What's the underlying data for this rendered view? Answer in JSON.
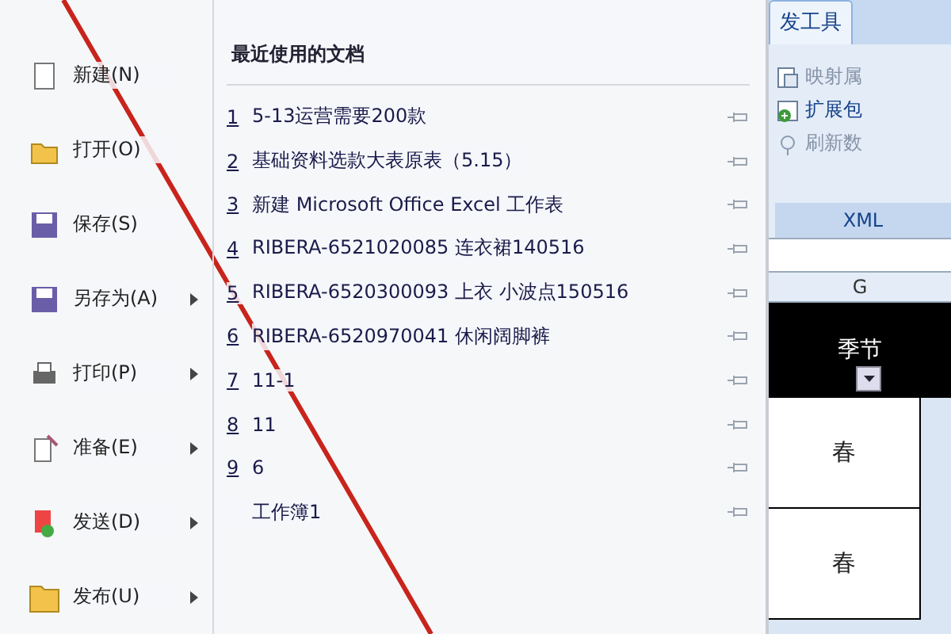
{
  "ribbon": {
    "tab": "发工具",
    "group": {
      "items": [
        {
          "label": "映射属"
        },
        {
          "label": "扩展包"
        },
        {
          "label": "刷新数"
        }
      ],
      "label": "XML"
    }
  },
  "sheet": {
    "column": "G",
    "header": "季节",
    "cells": [
      "春",
      "春"
    ]
  },
  "office_menu": {
    "commands": [
      {
        "label": "新建(N)",
        "submenu": false
      },
      {
        "label": "打开(O)",
        "submenu": false
      },
      {
        "label": "保存(S)",
        "submenu": false
      },
      {
        "label": "另存为(A)",
        "submenu": true
      },
      {
        "label": "打印(P)",
        "submenu": true
      },
      {
        "label": "准备(E)",
        "submenu": true
      },
      {
        "label": "发送(D)",
        "submenu": true
      },
      {
        "label": "发布(U)",
        "submenu": true
      }
    ],
    "recent": {
      "title": "最近使用的文档",
      "files": [
        {
          "number": "1",
          "name": "5-13运营需要200款"
        },
        {
          "number": "2",
          "name": "基础资料选款大表原表（5.15）"
        },
        {
          "number": "3",
          "name": "新建 Microsoft Office Excel 工作表"
        },
        {
          "number": "4",
          "name": "RIBERA-6521020085 连衣裙140516"
        },
        {
          "number": "5",
          "name": "RIBERA-6520300093 上衣 小波点150516"
        },
        {
          "number": "6",
          "name": "RIBERA-6520970041 休闲阔脚裤"
        },
        {
          "number": "7",
          "name": "11-1"
        },
        {
          "number": "8",
          "name": "11"
        },
        {
          "number": "9",
          "name": "6"
        },
        {
          "name": "工作簿1"
        }
      ]
    }
  },
  "annotations": [
    {
      "kind": "strike-line"
    }
  ]
}
